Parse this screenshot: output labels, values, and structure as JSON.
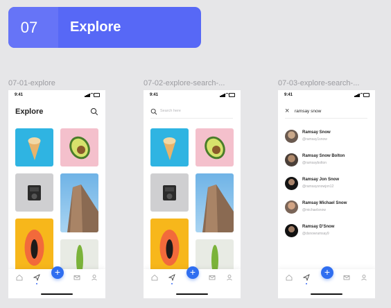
{
  "section": {
    "number": "07",
    "title": "Explore",
    "color": "#5768f6"
  },
  "frames": [
    {
      "label": "07-01-explore"
    },
    {
      "label": "07-02-explore-search-..."
    },
    {
      "label": "07-03-explore-search-..."
    }
  ],
  "status": {
    "time": "9:41"
  },
  "explore": {
    "title": "Explore"
  },
  "search": {
    "placeholder": "Search here",
    "query": "ramsay snow"
  },
  "users": [
    {
      "name": "Ramsay Snow",
      "handle": "@ramsay1snow"
    },
    {
      "name": "Ramsay Snow Bolton",
      "handle": "@ramsaybolton"
    },
    {
      "name": "Ramsay Jon Snow",
      "handle": "@ramsaysnowjon12"
    },
    {
      "name": "Ramsay Michael Snow",
      "handle": "@michaelsnow"
    },
    {
      "name": "Ramsay D'Snow",
      "handle": "@dsnowramsay9"
    }
  ],
  "fab": {
    "label": "+"
  },
  "accent": "#2f6ef0",
  "icons": [
    "search-icon",
    "close-icon",
    "home-icon",
    "send-icon",
    "mail-icon",
    "profile-icon",
    "plus-icon"
  ]
}
